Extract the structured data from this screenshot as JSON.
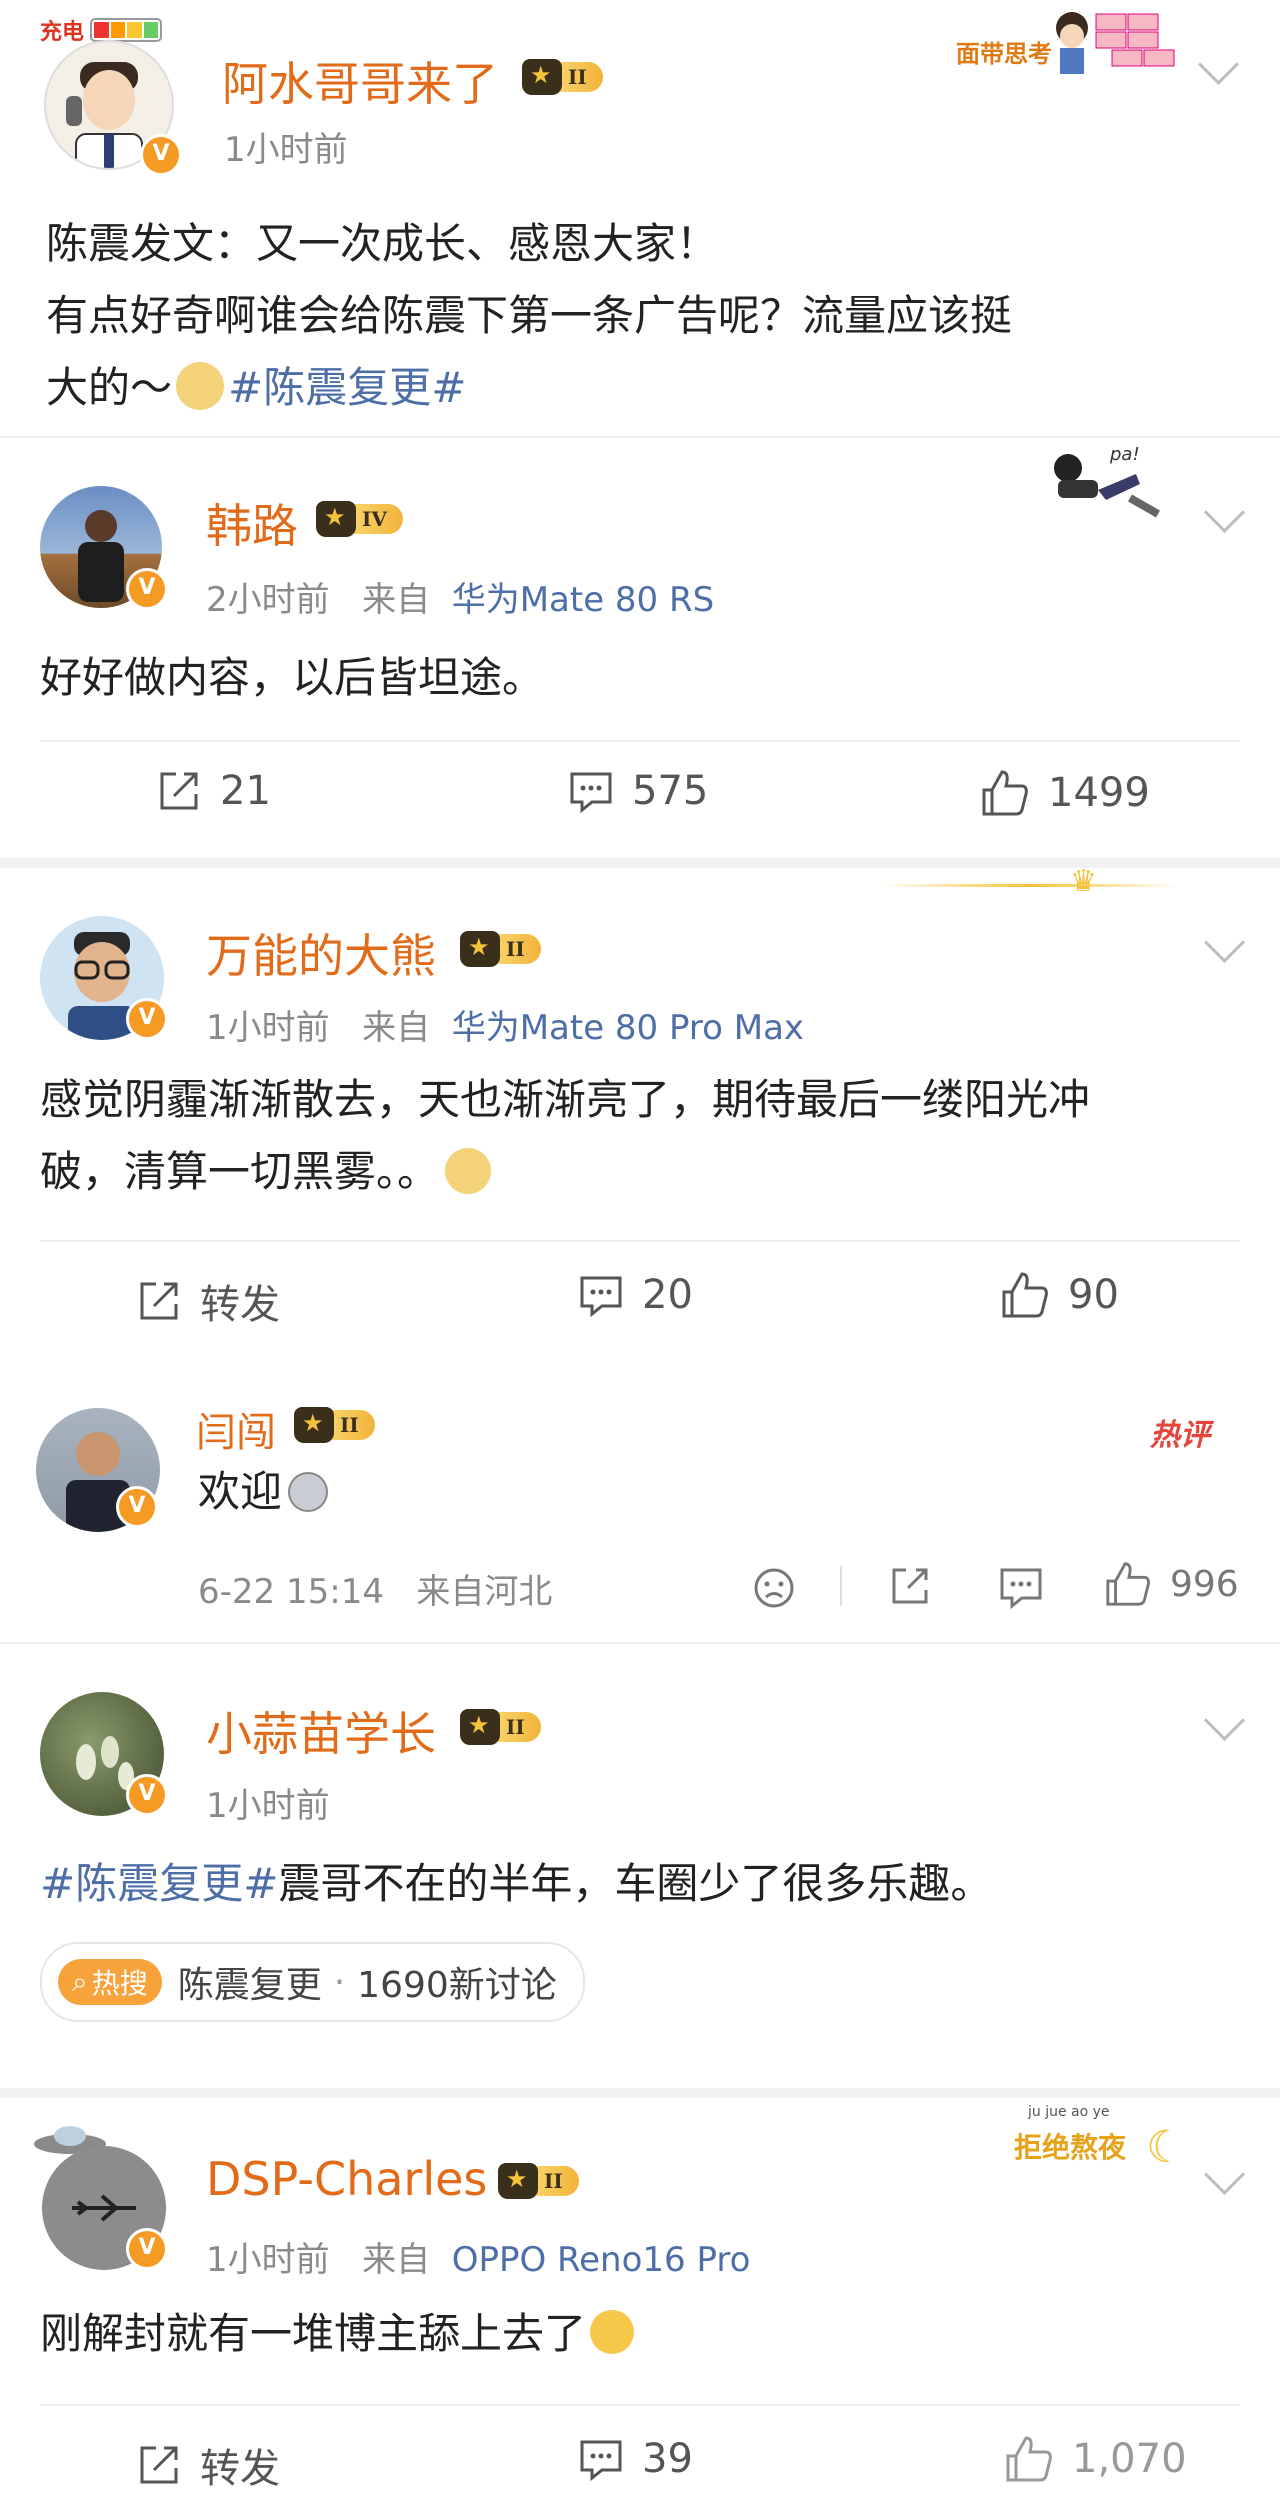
{
  "status_bar": {
    "charging_label": "充电"
  },
  "main_post": {
    "author": "阿水哥哥来了",
    "level": "II",
    "time": "1小时前",
    "content_line1": "陈震发文：又一次成长、感恩大家！",
    "content_line2": "有点好奇啊谁会给陈震下第一条广告呢？流量应该挺",
    "content_line3": "大的～",
    "hashtag": "#陈震复更#",
    "sticker_text": "面带思考"
  },
  "post_hanlu": {
    "author": "韩路",
    "level": "IV",
    "time": "2小时前",
    "from_label": "来自",
    "device": "华为Mate 80 RS",
    "content": "好好做内容，以后皆坦途。",
    "repost_count": "21",
    "comment_count": "575",
    "like_count": "1499",
    "sticker_text": "pa!"
  },
  "post_daxiong": {
    "author": "万能的大熊",
    "level": "II",
    "time": "1小时前",
    "from_label": "来自",
    "device": "华为Mate 80 Pro Max",
    "content_line1": "感觉阴霾渐渐散去，天也渐渐亮了，期待最后一缕阳光冲",
    "content_line2": "破，清算一切黑雾。。",
    "repost_label": "转发",
    "comment_count": "20",
    "like_count": "90"
  },
  "hot_comment": {
    "badge": "热评",
    "author": "闫闯",
    "level": "II",
    "content": "欢迎",
    "time": "6-22 15:14",
    "location": "来自河北",
    "like_count": "996"
  },
  "post_suanmiao": {
    "author": "小蒜苗学长",
    "level": "II",
    "time": "1小时前",
    "hashtag": "#陈震复更#",
    "content": "震哥不在的半年，车圈少了很多乐趣。",
    "topic_badge": "热搜",
    "topic_name": "陈震复更",
    "topic_count": "1690新讨论"
  },
  "post_charles": {
    "author": "DSP-Charles",
    "level": "II",
    "time": "1小时前",
    "from_label": "来自",
    "device": "OPPO Reno16 Pro",
    "content": "刚解封就有一堆博主舔上去了",
    "repost_label": "转发",
    "comment_count": "39",
    "like_count": "1,070",
    "sticker_text": "拒绝熬夜",
    "sticker_sub": "ju jue ao ye"
  },
  "colors": {
    "accent_orange": "#e26b1a",
    "link_blue": "#4e6ea8",
    "meta_gray": "#8a8a8a"
  }
}
